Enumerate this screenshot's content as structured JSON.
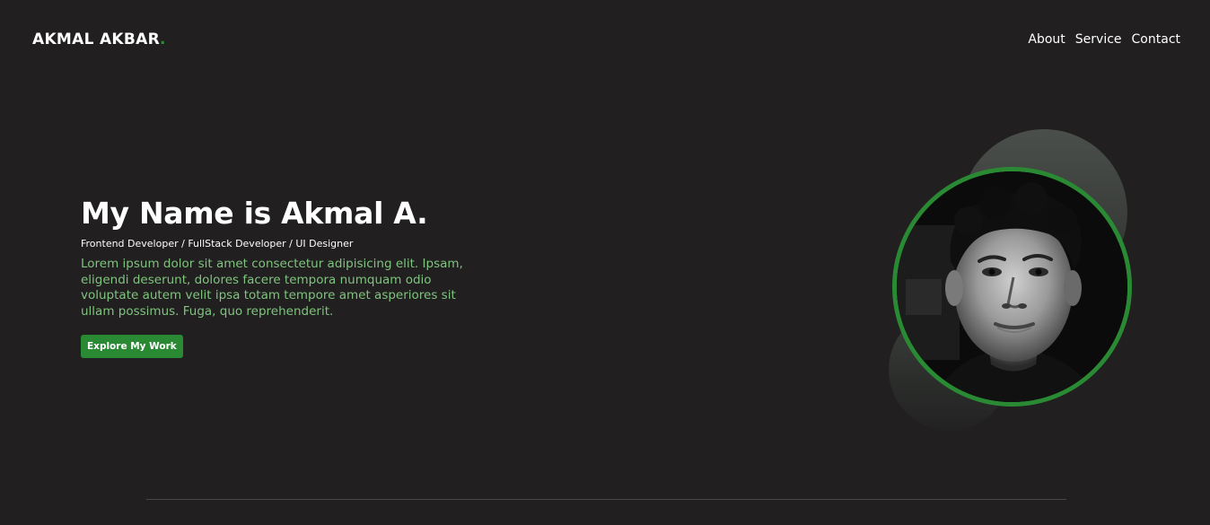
{
  "nav": {
    "brand": "AKMAL AKBAR",
    "brand_dot": ".",
    "links": [
      "About",
      "Service",
      "Contact"
    ]
  },
  "hero": {
    "title": "My Name is Akmal A.",
    "roles": "Frontend Developer / FullStack Developer / UI Designer",
    "description": "Lorem ipsum dolor sit amet consectetur adipisicing elit. Ipsam, eligendi deserunt, dolores facere tempora numquam odio voluptate autem velit ipsa totam tempore amet asperiores sit ullam possimus. Fuga, quo reprehenderit.",
    "cta_label": "Explore My Work"
  },
  "colors": {
    "background": "#211f1f",
    "accent": "#2a8a34",
    "description_text": "#7fc47f"
  }
}
